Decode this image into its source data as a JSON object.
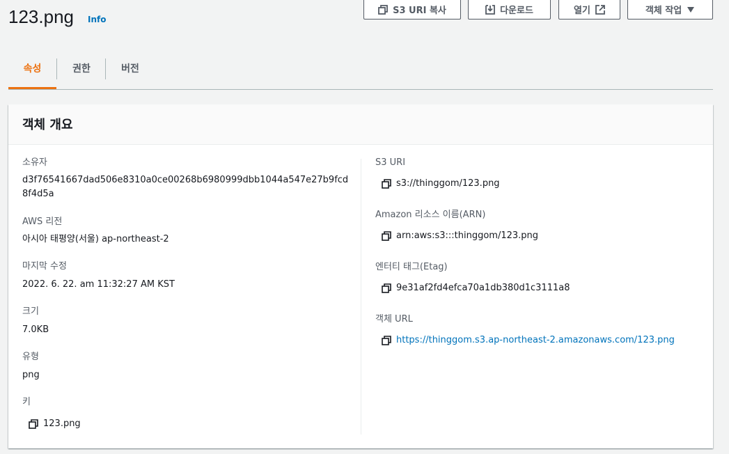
{
  "header": {
    "title": "123.png",
    "info_label": "Info",
    "buttons": {
      "copy_uri": "S3 URI 복사",
      "download": "다운로드",
      "open": "열기",
      "actions": "객체 작업"
    }
  },
  "tabs": [
    {
      "label": "속성",
      "active": true
    },
    {
      "label": "권한",
      "active": false
    },
    {
      "label": "버전",
      "active": false
    }
  ],
  "overview": {
    "title": "객체 개요",
    "left": {
      "owner": {
        "label": "소유자",
        "value": "d3f76541667dad506e8310a0ce00268b6980999dbb1044a547e27b9fcd8f4d5a"
      },
      "region": {
        "label": "AWS 리전",
        "value": "아시아 태평양(서울) ap-northeast-2"
      },
      "modified": {
        "label": "마지막 수정",
        "value": "2022. 6. 22. am 11:32:27 AM KST"
      },
      "size": {
        "label": "크기",
        "value": "7.0KB"
      },
      "type": {
        "label": "유형",
        "value": "png"
      },
      "key": {
        "label": "키",
        "value": "123.png"
      }
    },
    "right": {
      "s3_uri": {
        "label": "S3 URI",
        "value": "s3://thinggom/123.png"
      },
      "arn": {
        "label": "Amazon 리소스 이름(ARN)",
        "value": "arn:aws:s3:::thinggom/123.png"
      },
      "etag": {
        "label": "엔터티 태그(Etag)",
        "value": "9e31af2fd4efca70a1db380d1c3111a8"
      },
      "url": {
        "label": "객체 URL",
        "value": "https://thinggom.s3.ap-northeast-2.amazonaws.com/123.png"
      }
    }
  },
  "colors": {
    "accent": "#ec7211",
    "link": "#0073bb",
    "text": "#16191f",
    "muted": "#545b64"
  }
}
